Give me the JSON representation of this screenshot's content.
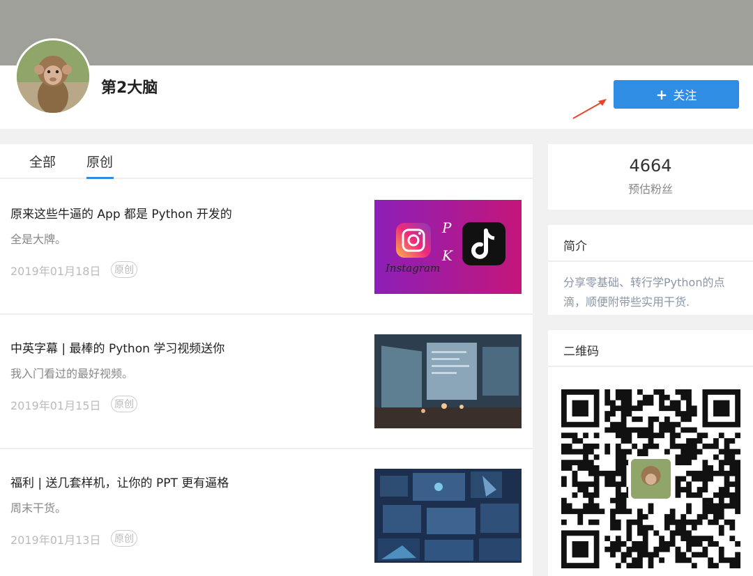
{
  "profile": {
    "name": "第2大脑",
    "follow_label": "关注"
  },
  "tabs": [
    {
      "label": "全部"
    },
    {
      "label": "原创"
    }
  ],
  "articles": [
    {
      "title": "原来这些牛逼的 App 都是 Python 开发的",
      "desc": "全是大牌。",
      "date": "2019年01月18日",
      "badge": "原创",
      "thumb_text": [
        "P",
        "K",
        "Instagram"
      ]
    },
    {
      "title": "中英字幕 | 最棒的 Python 学习视频送你",
      "desc": "我入门看过的最好视频。",
      "date": "2019年01月15日",
      "badge": "原创"
    },
    {
      "title": "福利 | 送几套样机，让你的 PPT 更有逼格",
      "desc": "周末干货。",
      "date": "2019年01月13日",
      "badge": "原创"
    }
  ],
  "sidebar": {
    "fans_count": "4664",
    "fans_label": "预估粉丝",
    "intro_title": "简介",
    "intro_text": "分享零基础、转行学Python的点滴，顺便附带些实用干货.",
    "qr_title": "二维码"
  },
  "colors": {
    "accent": "#2f8de4",
    "banner": "#a0a09a",
    "arrow": "#e8452c"
  }
}
